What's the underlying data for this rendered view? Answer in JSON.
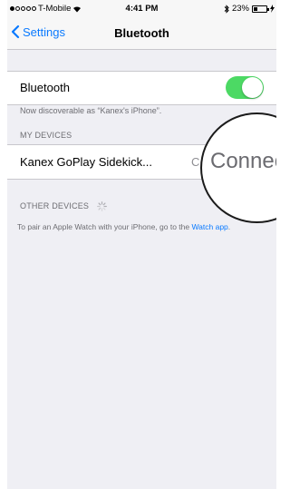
{
  "status_bar": {
    "carrier": "T-Mobile",
    "time": "4:41 PM",
    "battery_percent": "23%",
    "signal_bars_filled": 1,
    "signal_bars_total": 5,
    "icons": [
      "wifi-icon",
      "bluetooth-icon",
      "battery-icon",
      "charging-icon"
    ]
  },
  "nav": {
    "back_label": "Settings",
    "title": "Bluetooth"
  },
  "bluetooth_toggle": {
    "label": "Bluetooth",
    "state": "on"
  },
  "discoverable_text": "Now discoverable as “Kanex's iPhone”.",
  "my_devices": {
    "header": "MY DEVICES",
    "devices": [
      {
        "name": "Kanex GoPlay Sidekick...",
        "status_visible": "C",
        "status_magnified": "Connecte"
      }
    ]
  },
  "other_devices": {
    "header": "OTHER DEVICES"
  },
  "footer": {
    "text": "To pair an Apple Watch with your iPhone, go to the ",
    "link": "Watch app",
    "suffix": "."
  },
  "colors": {
    "accent": "#0a7aff",
    "toggle_on": "#4cd964",
    "background": "#efeff4"
  }
}
